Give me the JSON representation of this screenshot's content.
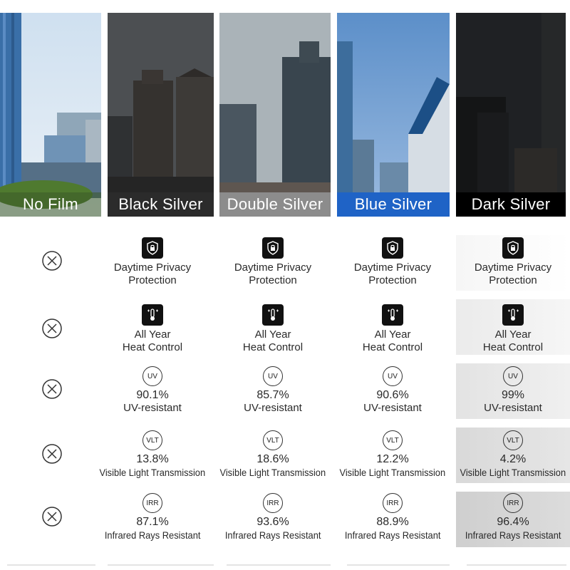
{
  "films": [
    {
      "name": "No Film"
    },
    {
      "name": "Black Silver"
    },
    {
      "name": "Double Silver"
    },
    {
      "name": "Blue Silver"
    },
    {
      "name": "Dark Silver"
    }
  ],
  "privacy": {
    "line1": "Daytime Privacy",
    "line2": "Protection"
  },
  "heat": {
    "line1": "All Year",
    "line2": "Heat Control"
  },
  "uv": {
    "badge": "UV",
    "label": "UV-resistant",
    "values": [
      "90.1%",
      "85.7%",
      "90.6%",
      "99%"
    ]
  },
  "vlt": {
    "badge": "VLT",
    "label": "Visible Light Transmission",
    "values": [
      "13.8%",
      "18.6%",
      "12.2%",
      "4.2%"
    ]
  },
  "irr": {
    "badge": "IRR",
    "label": "Infrared Rays Resistant",
    "values": [
      "87.1%",
      "93.6%",
      "88.9%",
      "96.4%"
    ]
  },
  "colors": {
    "black_silver": "#2b2b2b",
    "double_silver": "#8c8c8c",
    "blue_silver": "#1f63c6",
    "dark_silver": "#000000"
  }
}
